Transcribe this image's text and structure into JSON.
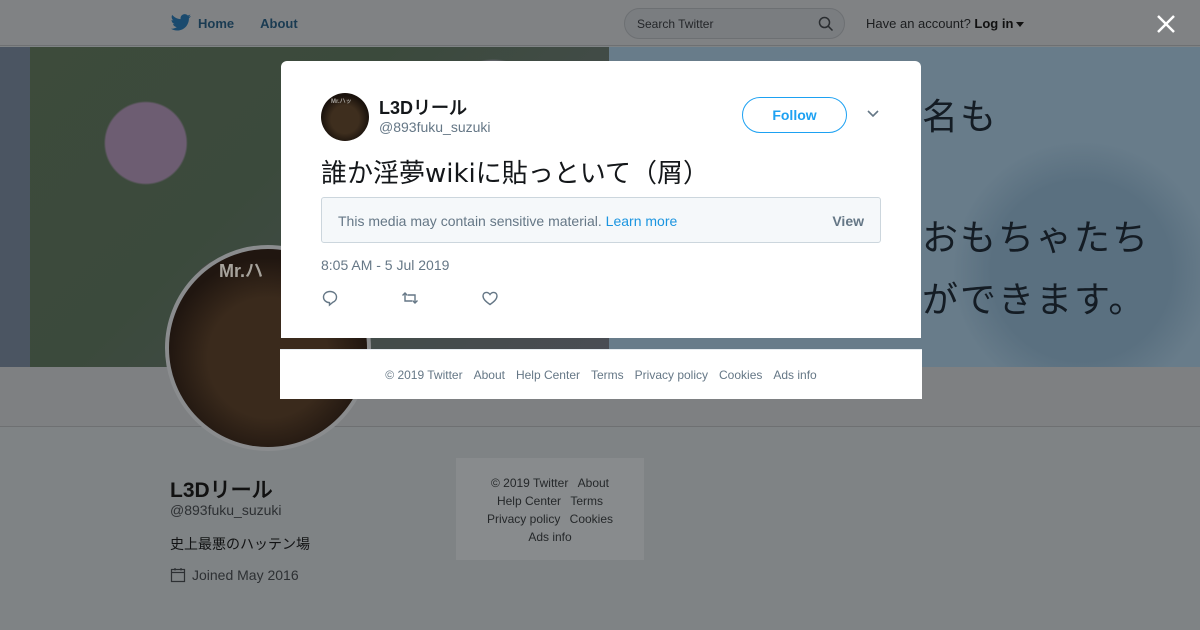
{
  "topbar": {
    "home_label": "Home",
    "about_label": "About",
    "search_placeholder": "Search Twitter",
    "account_prompt": "Have an account?",
    "login_label": "Log in"
  },
  "banner": {
    "text_lines": [
      "名も",
      "おもちゃたち",
      "ができます。"
    ]
  },
  "background_profile": {
    "avatar_text": "Mr.ハ",
    "name": "L3Dリール",
    "handle": "@893fuku_suzuki",
    "bio": "史上最悪のハッテン場",
    "joined": "Joined May 2016",
    "footer_links": [
      "© 2019 Twitter",
      "About",
      "Help Center",
      "Terms",
      "Privacy policy",
      "Cookies",
      "Ads info"
    ]
  },
  "tweet": {
    "avatar_text": "Mr.ハッ",
    "name": "L3Dリール",
    "handle": "@893fuku_suzuki",
    "follow_label": "Follow",
    "text": "誰か淫夢wikiに貼っといて（屑）",
    "sensitive_notice": "This media may contain sensitive material.",
    "learn_more_label": "Learn more",
    "view_label": "View",
    "timestamp": "8:05 AM - 5 Jul 2019"
  },
  "modal_footer": {
    "links": [
      "© 2019 Twitter",
      "About",
      "Help Center",
      "Terms",
      "Privacy policy",
      "Cookies",
      "Ads info"
    ]
  },
  "colors": {
    "accent": "#1da1f2",
    "link": "#1b95e0",
    "secondary_text": "#657786"
  },
  "icons": [
    "twitter-bird-icon",
    "search-icon",
    "close-icon",
    "chevron-down-icon",
    "reply-icon",
    "retweet-icon",
    "like-icon",
    "calendar-icon"
  ]
}
